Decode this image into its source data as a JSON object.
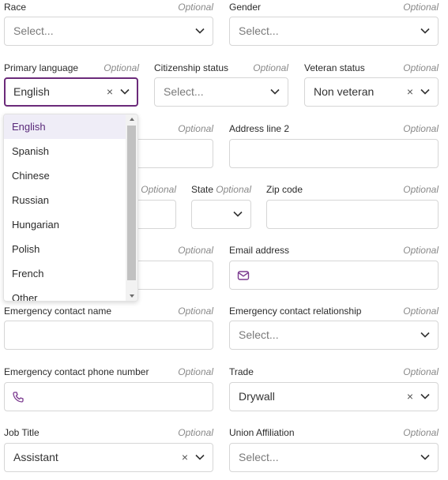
{
  "race": {
    "label": "Race",
    "optional": "Optional",
    "placeholder": "Select..."
  },
  "gender": {
    "label": "Gender",
    "optional": "Optional",
    "placeholder": "Select..."
  },
  "primary_language": {
    "label": "Primary language",
    "optional": "Optional",
    "value": "English",
    "clear": "×"
  },
  "citizenship": {
    "label": "Citizenship status",
    "optional": "Optional",
    "placeholder": "Select..."
  },
  "veteran": {
    "label": "Veteran status",
    "optional": "Optional",
    "value": "Non veteran",
    "clear": "×"
  },
  "address1": {
    "optional": "Optional"
  },
  "address2": {
    "label": "Address line 2",
    "optional": "Optional"
  },
  "city": {
    "optional": "Optional"
  },
  "state": {
    "label": "State",
    "optional": "Optional"
  },
  "zip": {
    "label": "Zip code",
    "optional": "Optional"
  },
  "phone": {
    "optional": "Optional"
  },
  "email": {
    "label": "Email address",
    "optional": "Optional"
  },
  "em_name": {
    "label": "Emergency contact name",
    "optional": "Optional"
  },
  "em_rel": {
    "label": "Emergency contact relationship",
    "optional": "Optional",
    "placeholder": "Select..."
  },
  "em_phone": {
    "label": "Emergency contact phone number",
    "optional": "Optional"
  },
  "trade": {
    "label": "Trade",
    "optional": "Optional",
    "value": "Drywall",
    "clear": "×"
  },
  "job_title": {
    "label": "Job Title",
    "optional": "Optional",
    "value": "Assistant",
    "clear": "×"
  },
  "union": {
    "label": "Union Affiliation",
    "optional": "Optional",
    "placeholder": "Select..."
  },
  "language_options": [
    "English",
    "Spanish",
    "Chinese",
    "Russian",
    "Hungarian",
    "Polish",
    "French",
    "Other"
  ],
  "selected_language": "English",
  "colors": {
    "accent": "#6b2a7a",
    "selected_bg": "#efedf7",
    "icon": "#7b3a8f"
  },
  "icons": {
    "chevron": "chevron-down-icon",
    "email": "envelope-icon",
    "phone": "phone-icon",
    "clear": "clear-icon"
  }
}
